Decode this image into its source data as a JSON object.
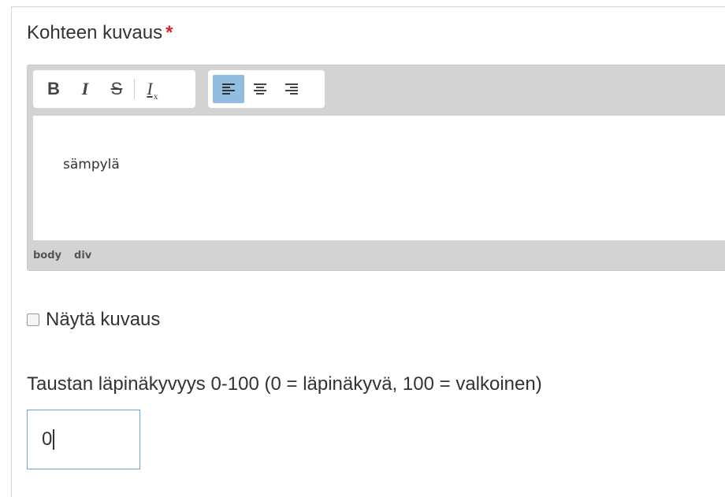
{
  "description_field": {
    "label": "Kohteen kuvaus",
    "required_mark": "*"
  },
  "editor": {
    "toolbar": {
      "bold": "B",
      "italic": "I",
      "strike": "S",
      "remove_format": "I",
      "remove_format_sub": "x",
      "align_left": "left-align-icon",
      "align_center": "center-align-icon",
      "align_right": "right-align-icon",
      "active_button": "align_left",
      "active_color": "#92bce0"
    },
    "content": "sämpylä",
    "path": [
      "body",
      "div"
    ]
  },
  "show_description": {
    "label": "Näytä kuvaus",
    "checked": false
  },
  "opacity_field": {
    "label": "Taustan läpinäkyvyys 0-100 (0 = läpinäkyvä, 100 = valkoinen)",
    "value": "0"
  }
}
